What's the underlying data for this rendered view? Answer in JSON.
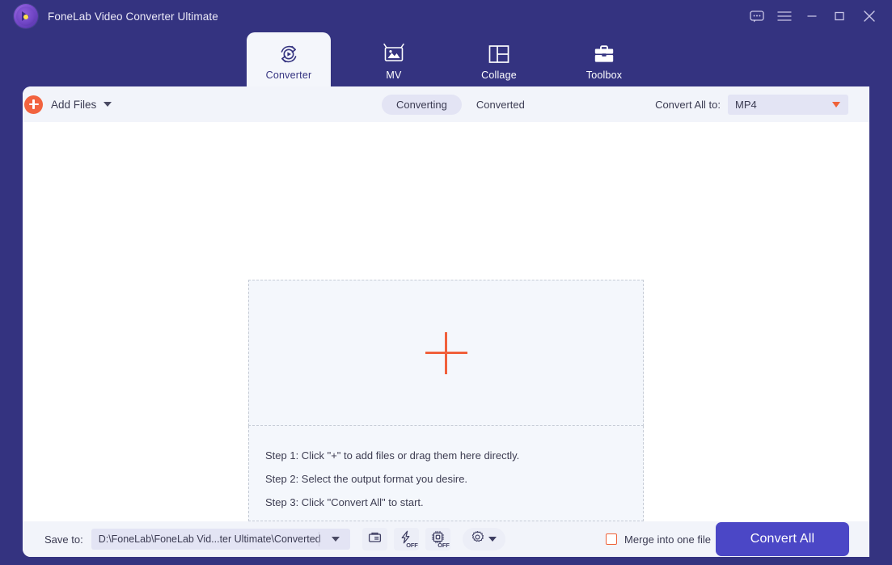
{
  "window": {
    "app_title": "FoneLab Video Converter Ultimate",
    "logo_icon": "fonelab-logo-icon",
    "controls": [
      {
        "name": "feedback-button",
        "icon": "chat-bubble-icon"
      },
      {
        "name": "menu-button",
        "icon": "hamburger-menu-icon"
      },
      {
        "name": "minimize-button",
        "icon": "minimize-icon"
      },
      {
        "name": "maximize-button",
        "icon": "maximize-icon"
      },
      {
        "name": "close-button",
        "icon": "close-icon"
      }
    ]
  },
  "nav": {
    "tabs": [
      {
        "label": "Converter",
        "icon": "convert-refresh-play-icon",
        "active": true
      },
      {
        "label": "MV",
        "icon": "picture-frame-icon",
        "active": false
      },
      {
        "label": "Collage",
        "icon": "layout-grid-icon",
        "active": false
      },
      {
        "label": "Toolbox",
        "icon": "briefcase-icon",
        "active": false
      }
    ]
  },
  "toolbar": {
    "add_files_label": "Add Files",
    "add_files_icon": "orange-plus-circle-icon",
    "add_files_caret_icon": "caret-down-icon",
    "segments": [
      {
        "label": "Converting",
        "selected": true
      },
      {
        "label": "Converted",
        "selected": false
      }
    ],
    "convert_all_to_label": "Convert All to:",
    "format_value": "MP4",
    "format_caret_icon": "caret-down-icon"
  },
  "content": {
    "dropzone_icon": "big-plus-icon",
    "steps": [
      "Step 1: Click \"+\" to add files or drag them here directly.",
      "Step 2: Select the output format you desire.",
      "Step 3: Click \"Convert All\" to start."
    ]
  },
  "bottom": {
    "save_to_label": "Save to:",
    "save_path": "D:\\FoneLab\\FoneLab Vid...ter Ultimate\\Converted",
    "path_caret_icon": "caret-down-icon",
    "buttons": [
      {
        "name": "open-folder-button",
        "icon": "folder-icon"
      },
      {
        "name": "hardware-acceleration-button",
        "icon": "lightning-bolt-icon",
        "state": "OFF"
      },
      {
        "name": "gpu-acceleration-button",
        "icon": "cpu-chip-icon",
        "state": "OFF"
      },
      {
        "name": "preferences-button",
        "icon": "gear-icon"
      }
    ],
    "merge_label": "Merge into one file",
    "merge_checked": false,
    "convert_all_label": "Convert All"
  },
  "colors": {
    "header_purple": "#343380",
    "accent_orange": "#f0603c",
    "primary_button": "#4b47c6",
    "toolbar_bg": "#f2f4fa",
    "pill_bg": "#e3e4f4",
    "dropzone_bg": "#f4f7fc"
  }
}
